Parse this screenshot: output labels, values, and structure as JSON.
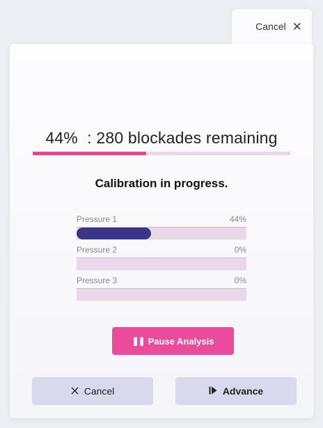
{
  "top_bar": {
    "cancel_label": "Cancel",
    "close_glyph": "✕"
  },
  "progress": {
    "percent_label": "44%",
    "remaining_text": ": 280 blockades remaining",
    "overall_fraction": 0.44,
    "accent_color": "#e94592"
  },
  "status_text": "Calibration in progress.",
  "sensors": [
    {
      "label": "Pressure 1",
      "value_label": "44%",
      "fraction": 0.44
    },
    {
      "label": "Pressure 2",
      "value_label": "0%",
      "fraction": 0
    },
    {
      "label": "Pressure 3",
      "value_label": "0%",
      "fraction": 0
    }
  ],
  "buttons": {
    "pause_label": "Pause Analysis",
    "pause_icon": "pause-icon",
    "cancel_label": "Cancel",
    "cancel_icon": "close-icon",
    "advance_label": "Advance",
    "advance_icon": "skip-forward-icon"
  },
  "colors": {
    "pause_button": "#ea4b9b",
    "sensor_fill": "#3b3487",
    "track": "#ead8ea",
    "secondary_button": "#d9d9ee"
  }
}
